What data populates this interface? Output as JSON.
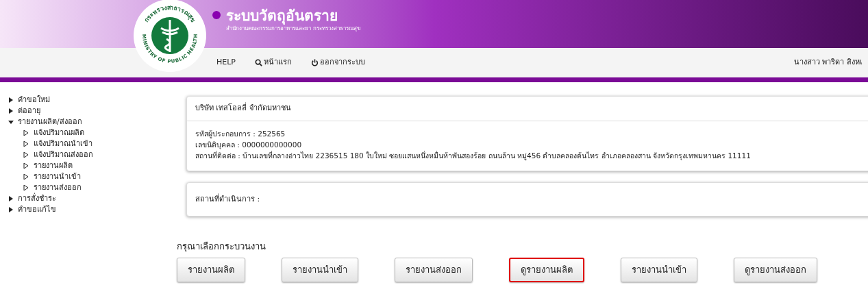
{
  "header": {
    "title": "ระบบวัตถุอันตราย",
    "subtitle": "สำนักงานคณะกรรมการอาหารและยา กระทรวงสาธารณสุข",
    "logo_top": "กระทรวงสาธารณสุข",
    "logo_bottom": "MINISTRY OF PUBLIC HEALTH"
  },
  "nav": {
    "items": [
      {
        "label": "HELP",
        "kind": "plain"
      },
      {
        "label": "หน้าแรก",
        "kind": "search"
      },
      {
        "label": "ออกจากระบบ",
        "kind": "power"
      }
    ],
    "user": "นางสาว พาริดา สิงหเ"
  },
  "sidebar": {
    "items": [
      {
        "label": "คำขอใหม่",
        "expanded": false
      },
      {
        "label": "ต่ออายุ",
        "expanded": false
      },
      {
        "label": "รายงานผลิต/ส่งออก",
        "expanded": true,
        "children": [
          {
            "label": "แจ้งปริมาณผลิต"
          },
          {
            "label": "แจ้งปริมาณนำเข้า"
          },
          {
            "label": "แจ้งปริมาณส่งออก"
          },
          {
            "label": "รายงานผลิต"
          },
          {
            "label": "รายงานนำเข้า"
          },
          {
            "label": "รายงานส่งออก"
          }
        ]
      },
      {
        "label": "การสั่งชำระ",
        "expanded": false
      },
      {
        "label": "คำขอแก้ไข",
        "expanded": false
      }
    ]
  },
  "company_card": {
    "name": "บริษัท เทสโอลลี่ จำกัดมหาชน",
    "lines": [
      "รหัสผู้ประกอบการ : 252565",
      "เลขนิติบุคคล : 0000000000000",
      "สถานที่ติดต่อ : บ้านเลขที่กลางอ่าวไทย 2236515 180 ใบใหม่ ซอยแสนหนึ่งหมื่นห้าพันสองร้อย ถนนล้าน หมู่456 ตำบลคลองต้นไทร อำเภอคลองสาน จังหวัดกรุงเทพมหานคร 11111"
    ]
  },
  "location_card": {
    "label": "สถานที่ดำเนินการ :"
  },
  "process": {
    "prompt": "กรุณาเลือกกระบวนงาน",
    "buttons": [
      {
        "label": "รายงานผลิต",
        "selected": false
      },
      {
        "label": "รายงานนำเข้า",
        "selected": false
      },
      {
        "label": "รายงานส่งออก",
        "selected": false
      },
      {
        "label": "ดูรายงานผลิต",
        "selected": true
      },
      {
        "label": "รายงานนำเข้า",
        "selected": false
      },
      {
        "label": "ดูรายงานส่งออก",
        "selected": false
      }
    ]
  }
}
